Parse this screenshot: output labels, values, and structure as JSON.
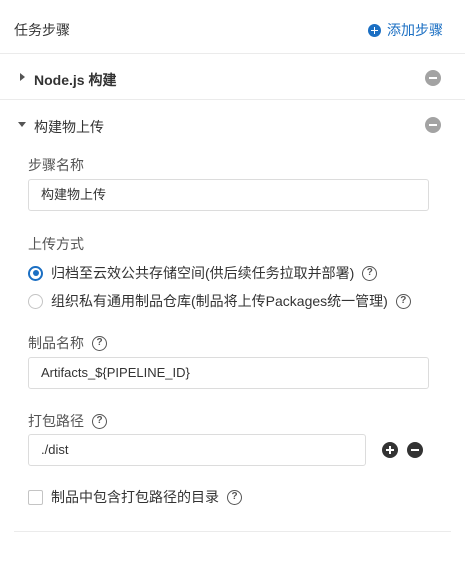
{
  "header": {
    "title": "任务步骤",
    "add_step_label": "添加步骤"
  },
  "steps": [
    {
      "label": "Node.js 构建",
      "expanded": false
    },
    {
      "label": "构建物上传",
      "expanded": true
    }
  ],
  "form": {
    "step_name": {
      "label": "步骤名称",
      "value": "构建物上传"
    },
    "upload_method": {
      "label": "上传方式",
      "options": [
        {
          "label": "归档至云效公共存储空间(供后续任务拉取并部署)",
          "checked": true
        },
        {
          "label": "组织私有通用制品仓库(制品将上传Packages统一管理)",
          "checked": false
        }
      ]
    },
    "artifact_name": {
      "label": "制品名称",
      "value": "Artifacts_${PIPELINE_ID}"
    },
    "package_path": {
      "label": "打包路径",
      "value": "./dist"
    },
    "include_dir": {
      "label": "制品中包含打包路径的目录",
      "checked": false
    },
    "help_glyph": "?"
  },
  "colors": {
    "accent": "#1b6fc3",
    "remove_icon": "#a3a3a3"
  }
}
